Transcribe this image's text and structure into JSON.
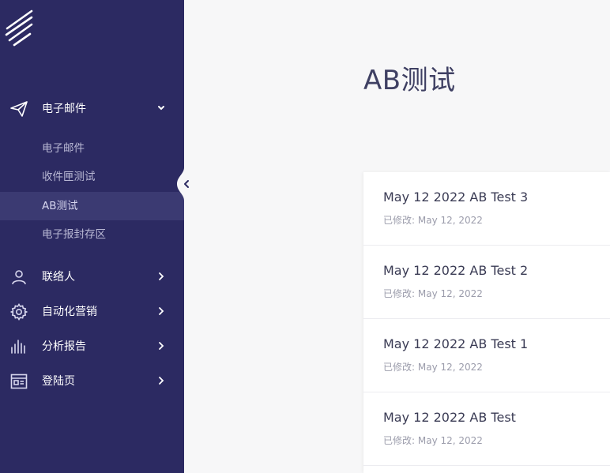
{
  "sidebar": {
    "groups": [
      {
        "label": "电子邮件",
        "icon": "paper-plane-icon",
        "expanded": true
      },
      {
        "label": "联络人",
        "icon": "user-icon"
      },
      {
        "label": "自动化营销",
        "icon": "gear-icon"
      },
      {
        "label": "分析报告",
        "icon": "bar-chart-icon"
      },
      {
        "label": "登陆页",
        "icon": "landing-page-icon"
      }
    ],
    "email_subitems": [
      {
        "label": "电子邮件"
      },
      {
        "label": "收件匣测试"
      },
      {
        "label": "AB测试",
        "active": true
      },
      {
        "label": "电子报封存区"
      }
    ]
  },
  "main": {
    "title": "AB测试",
    "items": [
      {
        "title": "May 12 2022 AB Test 3",
        "modified_label": "已修改: ",
        "modified_date": "May 12, 2022"
      },
      {
        "title": "May 12 2022 AB Test 2",
        "modified_label": "已修改: ",
        "modified_date": "May 12, 2022"
      },
      {
        "title": "May 12 2022 AB Test 1",
        "modified_label": "已修改: ",
        "modified_date": "May 12, 2022"
      },
      {
        "title": "May 12 2022 AB Test",
        "modified_label": "已修改: ",
        "modified_date": "May 12, 2022"
      }
    ]
  },
  "colors": {
    "sidebar_bg": "#2c2a62",
    "sidebar_active_bg": "#3b3a72",
    "page_bg": "#f7f7f8",
    "title_text": "#3f4063"
  }
}
